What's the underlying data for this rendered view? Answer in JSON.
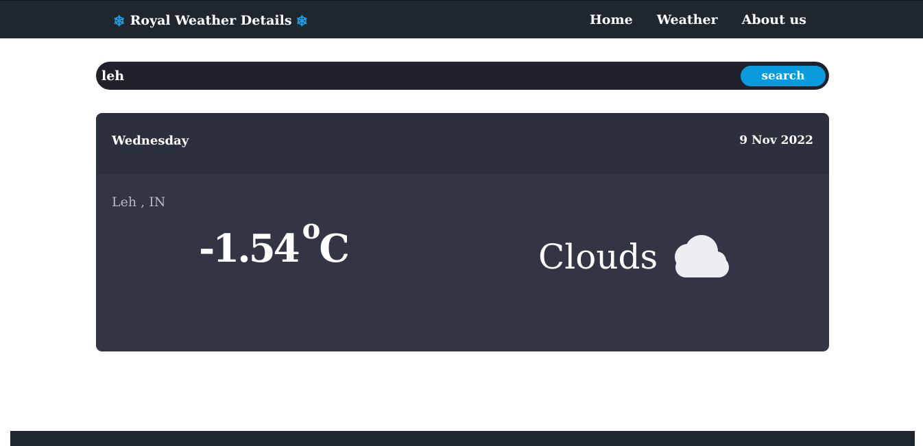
{
  "navbar": {
    "brand_text": "Royal Weather Details",
    "brand_icon": "snowflake-icon",
    "brand_icon_glyph": "❄",
    "brand_color": "#1e9be3",
    "links": [
      "Home",
      "Weather",
      "About us"
    ]
  },
  "search": {
    "value": "leh",
    "button_label": "search",
    "button_color": "#0a9ade"
  },
  "weather": {
    "day": "Wednesday",
    "date": "9 Nov 2022",
    "location": "Leh , IN",
    "temperature": "-1.54",
    "degree_symbol": "o",
    "unit": "C",
    "condition": "Clouds",
    "condition_icon": "cloud-icon"
  },
  "colors": {
    "navbar_bg": "#1f262e",
    "card_bg": "#333545",
    "card_header_bg": "#2c2f3c",
    "search_bg": "#20212b"
  }
}
